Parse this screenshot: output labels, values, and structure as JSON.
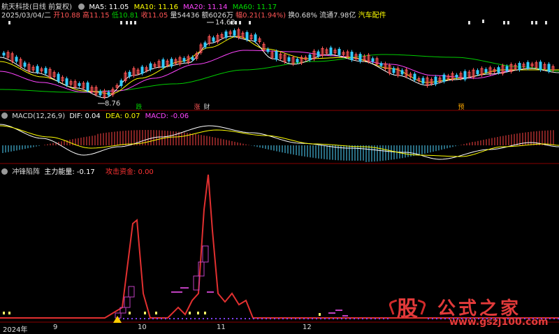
{
  "header": {
    "stock_name": "航天科技(日线 前复权)",
    "ma5": "MA5: 11.05",
    "ma10": "MA10: 11.16",
    "ma20": "MA20: 11.14",
    "ma60": "MA60: 11.17",
    "colors": {
      "ma5": "#ffffff",
      "ma10": "#ffff00",
      "ma20": "#ff44ff",
      "ma60": "#00dd00"
    }
  },
  "quote": {
    "date": "2025/03/04/二",
    "open": "开10.88",
    "high": "高11.15",
    "low": "低10.81",
    "close": "收11.05",
    "volume": "量54436",
    "amount": "额6026万",
    "change": "幅0.21(1.94%)",
    "turnover": "换0.68%",
    "float_cap": "流通7.98亿",
    "sector": "汽车配件"
  },
  "price_panel": {
    "high_mark": "14.63",
    "low_mark": "8.76",
    "markers": [
      {
        "text": "跌",
        "color": "#00cc00"
      },
      {
        "text": "涨",
        "color": "#ff5555"
      },
      {
        "text": "财",
        "color": "#cccccc"
      },
      {
        "text": "预",
        "color": "#ffaa00"
      }
    ]
  },
  "macd": {
    "title": "MACD(12,26,9)",
    "dif": "DIF: 0.04",
    "dea": "DEA: 0.07",
    "macd": "MACD: -0.06"
  },
  "indicator": {
    "title": "冲锋陷阵",
    "main_force": "主力能量: -0.17",
    "attack_fund": "攻击资金: 0.00"
  },
  "x_axis": {
    "ticks": [
      "2024年",
      "9",
      "10",
      "11",
      "12"
    ]
  },
  "watermark": {
    "logo_char": "股",
    "brand": "公式之家",
    "url": "www.gszj100.com"
  }
}
